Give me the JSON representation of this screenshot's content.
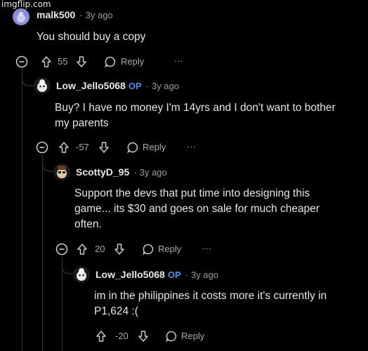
{
  "watermark": "imgflip.com",
  "comments": [
    {
      "username": "malk500",
      "op_badge": "",
      "separator": "·",
      "age": "3y ago",
      "lines": [
        "You should buy a copy"
      ],
      "score": "55",
      "reply_label": "Reply",
      "more": "···"
    },
    {
      "username": "Low_Jello5068",
      "op_badge": "OP",
      "separator": "·",
      "age": "3y ago",
      "lines": [
        "Buy? I have no money I'm 14yrs and I don't want to bother",
        "my parents"
      ],
      "score": "-57",
      "reply_label": "Reply",
      "more": "···"
    },
    {
      "username": "ScottyD_95",
      "op_badge": "",
      "separator": "·",
      "age": "3y ago",
      "lines": [
        "Support the devs that put time into designing this",
        "game... its $30 and goes on sale for much cheaper",
        "often."
      ],
      "score": "20",
      "reply_label": "Reply",
      "more": "···"
    },
    {
      "username": "Low_Jello5068",
      "op_badge": "OP",
      "separator": "·",
      "age": "3y ago",
      "lines": [
        "im in the philippines it costs more it's currently in",
        "P1,624 :("
      ],
      "score": "-20",
      "reply_label": "Reply",
      "more": ""
    }
  ],
  "icons": {
    "collapse": "collapse-thread-icon",
    "upvote": "upvote-arrow-icon",
    "downvote": "downvote-arrow-icon",
    "reply": "reply-bubble-icon",
    "more": "more-options-icon"
  },
  "colors": {
    "background": "#000000",
    "op_badge": "#4f8fea",
    "thread_line": "#343536"
  }
}
